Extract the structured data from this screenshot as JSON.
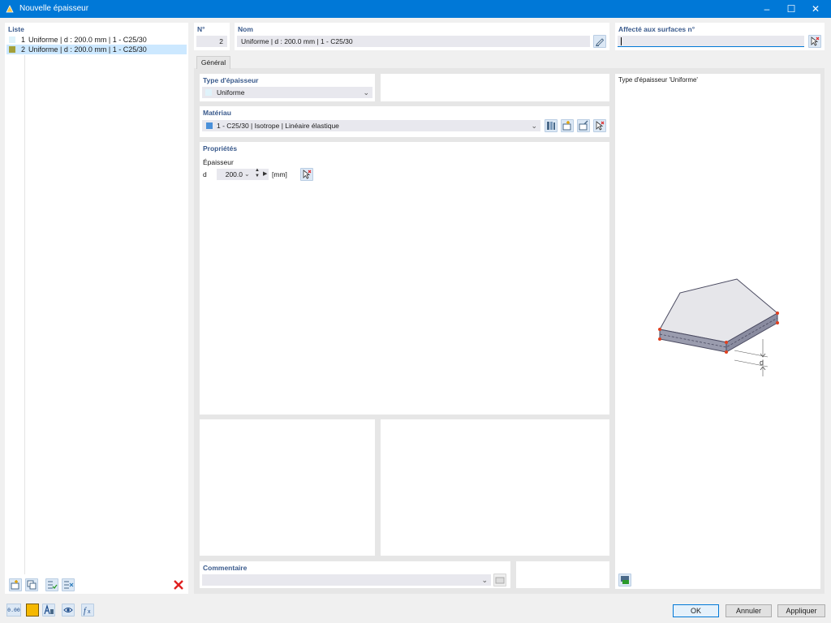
{
  "window": {
    "title": "Nouvelle épaisseur"
  },
  "colors": {
    "titlebar": "#0078d7",
    "label": "#3a5a8c",
    "row_selected": "#cce8ff",
    "material_swatch": "#4a90d9",
    "item2_swatch": "#a3a03a"
  },
  "list": {
    "header": "Liste",
    "items": [
      {
        "num": "1",
        "text": "Uniforme | d : 200.0 mm | 1 - C25/30"
      },
      {
        "num": "2",
        "text": "Uniforme | d : 200.0 mm | 1 - C25/30"
      }
    ]
  },
  "number": {
    "label": "N°",
    "value": "2"
  },
  "name": {
    "label": "Nom",
    "value": "Uniforme | d : 200.0 mm | 1 - C25/30"
  },
  "assigned": {
    "label": "Affecté aux surfaces n°",
    "value": ""
  },
  "tab": {
    "label": "Général"
  },
  "thickness_type": {
    "label": "Type d'épaisseur",
    "value": "Uniforme"
  },
  "material": {
    "label": "Matériau",
    "value": "1 - C25/30 | Isotrope | Linéaire élastique"
  },
  "properties": {
    "label": "Propriétés",
    "thickness_label": "Épaisseur",
    "symbol": "d",
    "value": "200.0",
    "unit": "[mm]"
  },
  "comment": {
    "label": "Commentaire",
    "value": ""
  },
  "preview": {
    "title": "Type d'épaisseur  'Uniforme'",
    "dim_label": "d"
  },
  "footer": {
    "decimals_badge": "0.00",
    "ok": "OK",
    "cancel": "Annuler",
    "apply": "Appliquer"
  }
}
